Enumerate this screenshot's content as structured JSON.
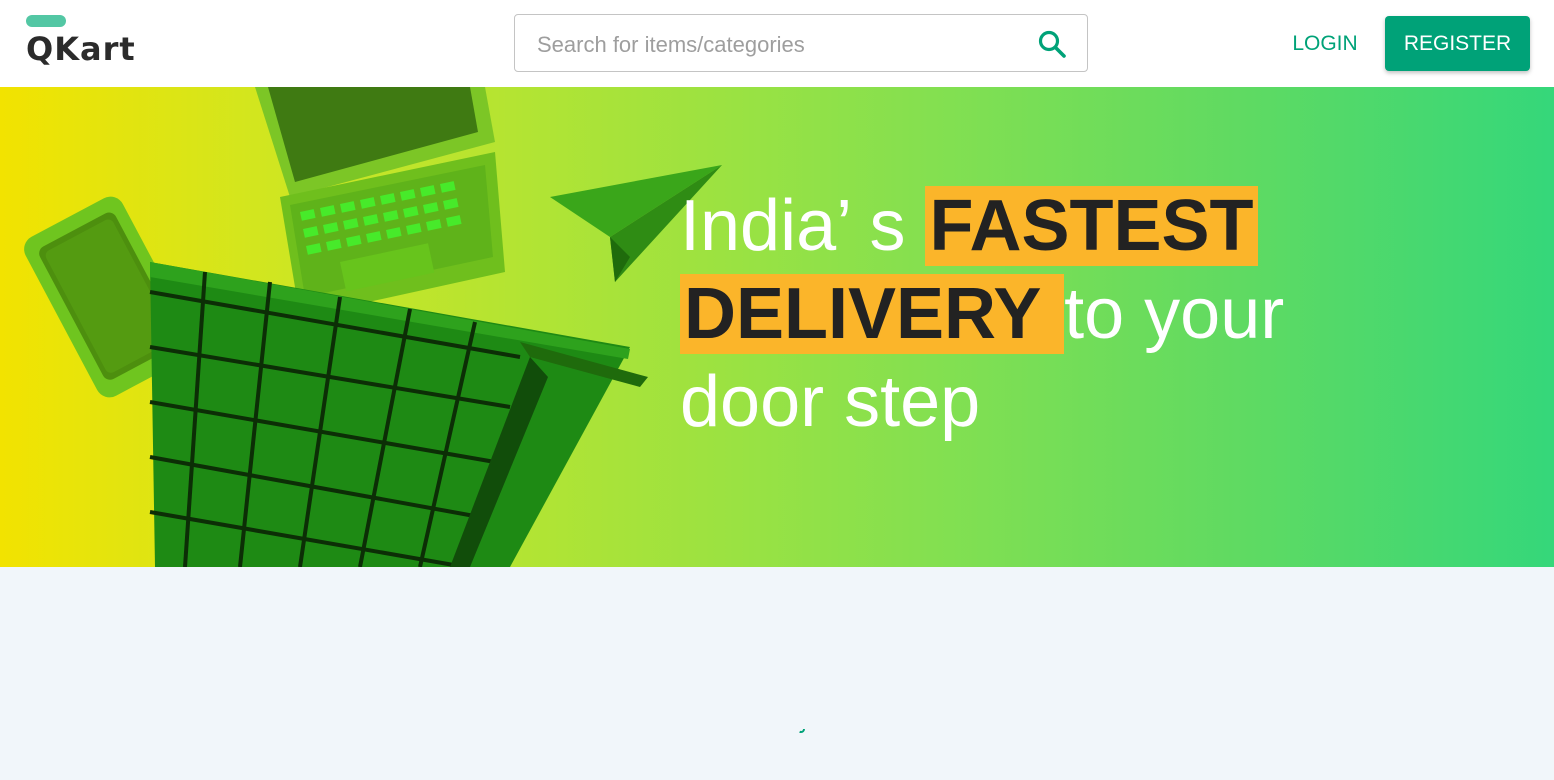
{
  "header": {
    "logo_text": "QKart",
    "search": {
      "placeholder": "Search for items/categories",
      "value": "",
      "icon": "search-icon"
    },
    "login_label": "LOGIN",
    "register_label": "REGISTER"
  },
  "hero": {
    "line1_plain": "India’ s ",
    "line1_highlight": "FASTEST",
    "line2_highlight": "DELIVERY ",
    "line2_plain": " to your",
    "line3_plain": "door step"
  },
  "colors": {
    "brand": "#00a278",
    "logo_accent": "#53c7a4",
    "highlight": "#fbb52a",
    "page_bg": "#f1f6fa"
  }
}
